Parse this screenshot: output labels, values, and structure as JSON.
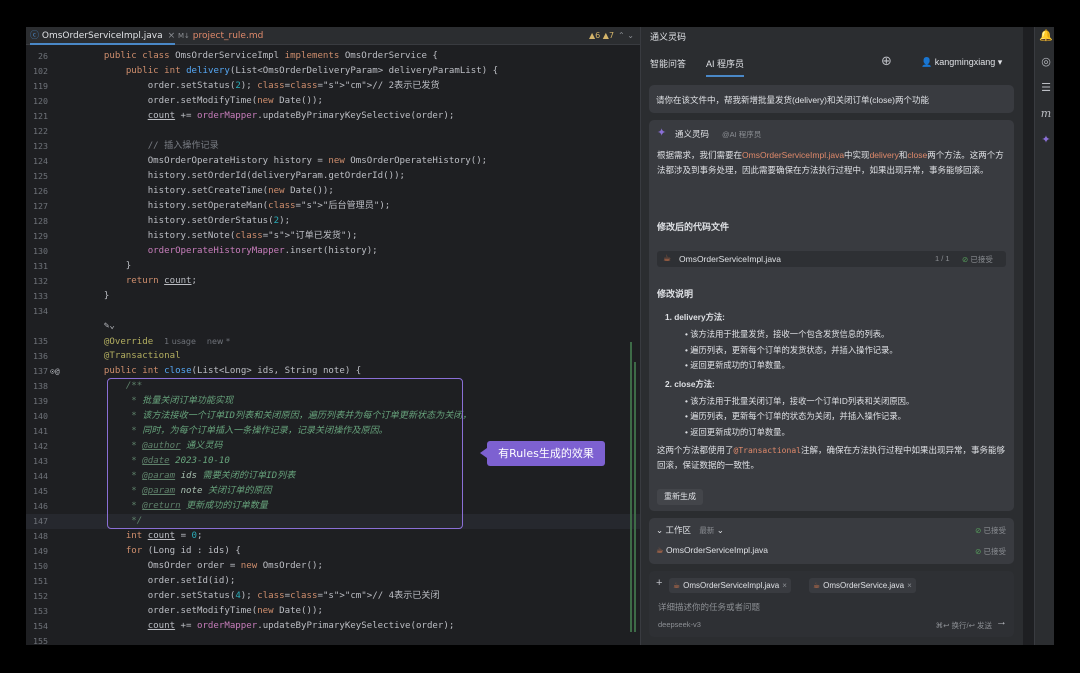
{
  "editor": {
    "tabs": [
      {
        "label": "OmsOrderServiceImpl.java",
        "close": "×"
      },
      {
        "label": "project_rule.md",
        "prefix": "M↓"
      }
    ],
    "warnings": "▲6 ▲7",
    "nav": "⌃ ⌄",
    "lines": [
      {
        "n": "26",
        "t": "    public class OmsOrderServiceImpl implements OmsOrderService {"
      },
      {
        "n": "102",
        "t": "        public int delivery(List<OmsOrderDeliveryParam> deliveryParamList) {"
      },
      {
        "n": "119",
        "t": "            order.setStatus(2); // 2表示已发货"
      },
      {
        "n": "120",
        "t": "            order.setModifyTime(new Date());"
      },
      {
        "n": "121",
        "t": "            count += orderMapper.updateByPrimaryKeySelective(order);"
      },
      {
        "n": "122",
        "t": ""
      },
      {
        "n": "123",
        "t": "            // 插入操作记录"
      },
      {
        "n": "124",
        "t": "            OmsOrderOperateHistory history = new OmsOrderOperateHistory();"
      },
      {
        "n": "125",
        "t": "            history.setOrderId(deliveryParam.getOrderId());"
      },
      {
        "n": "126",
        "t": "            history.setCreateTime(new Date());"
      },
      {
        "n": "127",
        "t": "            history.setOperateMan(\"后台管理员\");"
      },
      {
        "n": "128",
        "t": "            history.setOrderStatus(2);"
      },
      {
        "n": "129",
        "t": "            history.setNote(\"订单已发货\");"
      },
      {
        "n": "130",
        "t": "            orderOperateHistoryMapper.insert(history);"
      },
      {
        "n": "131",
        "t": "        }"
      },
      {
        "n": "132",
        "t": "        return count;"
      },
      {
        "n": "133",
        "t": "    }"
      },
      {
        "n": "134",
        "t": ""
      },
      {
        "n": "",
        "t": "    ✎⌄"
      },
      {
        "n": "135",
        "t": "    @Override  1 usage  new *"
      },
      {
        "n": "136",
        "t": "    @Transactional"
      },
      {
        "n": "137",
        "t": "    public int close(List<Long> ids, String note) {"
      },
      {
        "n": "138",
        "t": "        /**"
      },
      {
        "n": "139",
        "t": "         * 批量关闭订单功能实现"
      },
      {
        "n": "140",
        "t": "         * 该方法接收一个订单ID列表和关闭原因，遍历列表并为每个订单更新状态为关闭，"
      },
      {
        "n": "141",
        "t": "         * 同时，为每个订单插入一条操作记录，记录关闭操作及原因。"
      },
      {
        "n": "142",
        "t": "         * @author 通义灵码"
      },
      {
        "n": "143",
        "t": "         * @date 2023-10-10"
      },
      {
        "n": "144",
        "t": "         * @param ids 需要关闭的订单ID列表"
      },
      {
        "n": "145",
        "t": "         * @param note 关闭订单的原因"
      },
      {
        "n": "146",
        "t": "         * @return 更新成功的订单数量"
      },
      {
        "n": "147",
        "t": "         */"
      },
      {
        "n": "148",
        "t": "        int count = 0;"
      },
      {
        "n": "149",
        "t": "        for (Long id : ids) {"
      },
      {
        "n": "150",
        "t": "            OmsOrder order = new OmsOrder();"
      },
      {
        "n": "151",
        "t": "            order.setId(id);"
      },
      {
        "n": "152",
        "t": "            order.setStatus(4); // 4表示已关闭"
      },
      {
        "n": "153",
        "t": "            order.setModifyTime(new Date());"
      },
      {
        "n": "154",
        "t": "            count += orderMapper.updateByPrimaryKeySelective(order);"
      },
      {
        "n": "155",
        "t": ""
      }
    ],
    "callout": "有Rules生成的效果"
  },
  "panel": {
    "title": "通义灵码",
    "tabs": [
      "智能问答",
      "AI 程序员"
    ],
    "user": "kangmingxiang",
    "question": "请你在该文件中，帮我新增批量发货(delivery)和关闭订单(close)两个功能",
    "bot_name": "通义灵码",
    "bot_sub": "@AI 程序员",
    "intro_a": "根据需求，我们需要在",
    "intro_file": "OmsOrderServiceImpl.java",
    "intro_b": "中实现",
    "intro_m1": "delivery",
    "intro_and": "和",
    "intro_m2": "close",
    "intro_c": "两个方法。这两个方法都涉及到事务处理，因此需要确保在方法执行过程中，如果出现异常，事务能够回滚。",
    "h_files": "修改后的代码文件",
    "file": {
      "name": "OmsOrderServiceImpl.java",
      "page": "1 / 1",
      "status": "已接受"
    },
    "h_notes": "修改说明",
    "items": [
      {
        "title": "1. delivery方法:",
        "points": [
          "该方法用于批量发货，接收一个包含发货信息的列表。",
          "遍历列表，更新每个订单的发货状态，并插入操作记录。",
          "返回更新成功的订单数量。"
        ]
      },
      {
        "title": "2. close方法:",
        "points": [
          "该方法用于批量关闭订单，接收一个订单ID列表和关闭原因。",
          "遍历列表，更新每个订单的状态为关闭，并插入操作记录。",
          "返回更新成功的订单数量。"
        ]
      }
    ],
    "summary_a": "这两个方法都使用了",
    "summary_code": "@Transactional",
    "summary_b": "注解，确保在方法执行过程中如果出现异常，事务能够回滚，保证数据的一致性。",
    "regen": "重新生成",
    "workspace": {
      "label": "工作区",
      "sub": "最新",
      "status": "已接受",
      "file": "OmsOrderServiceImpl.java",
      "file_status": "已接受"
    },
    "input": {
      "chips": [
        "OmsOrderServiceImpl.java",
        "OmsOrderService.java"
      ],
      "placeholder": "详细描述你的任务或者问题",
      "model": "deepseek-v3",
      "hint": "⌘↩ 换行/↩ 发送"
    }
  }
}
